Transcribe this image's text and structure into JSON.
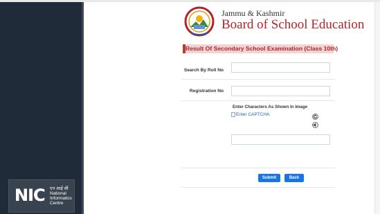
{
  "sidebar": {
    "nic_logo": {
      "letters": "NIC",
      "hindi": "एन आई सी",
      "line1": "National",
      "line2": "Informatics",
      "line3": "Centre"
    }
  },
  "header": {
    "brand_line1": "Jammu & Kashmir",
    "brand_line2": "Board of School Education",
    "emblem_icon": "jkbose-emblem-icon"
  },
  "form": {
    "title": "Result Of Secondary School Examination (Class 10th)",
    "roll_label": "Search By Roll No",
    "roll_value": "",
    "registration_label": "Registration No",
    "registration_value": "",
    "captcha_heading": "Enter Characters As Shown In Image",
    "captcha_alt": "Enter CAPTCHA",
    "captcha_value": "",
    "refresh_icon": "refresh-icon",
    "audio_icon": "audio-icon",
    "submit_label": "Submit",
    "back_label": "Back"
  },
  "colors": {
    "sidebar_bg": "#1f2b38",
    "title_text": "#b22222",
    "title_bg": "#f2d4d4",
    "button_blue": "#1a73e8",
    "brand_red": "#b2232b"
  }
}
